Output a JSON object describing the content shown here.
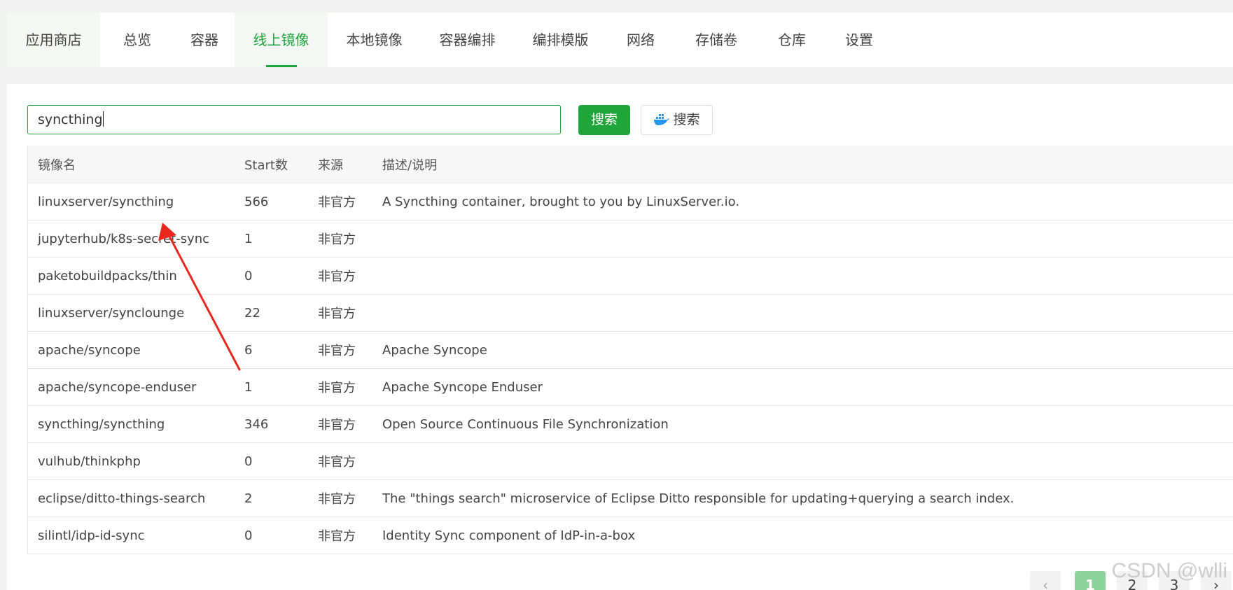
{
  "tabs": [
    {
      "label": "应用商店"
    },
    {
      "label": "总览"
    },
    {
      "label": "容器"
    },
    {
      "label": "线上镜像"
    },
    {
      "label": "本地镜像"
    },
    {
      "label": "容器编排"
    },
    {
      "label": "编排模版"
    },
    {
      "label": "网络"
    },
    {
      "label": "存储卷"
    },
    {
      "label": "仓库"
    },
    {
      "label": "设置"
    }
  ],
  "search": {
    "value": "syncthing",
    "button_label": "搜索",
    "docker_button_label": "搜索"
  },
  "table": {
    "headers": [
      "镜像名",
      "Start数",
      "来源",
      "描述/说明"
    ],
    "rows": [
      {
        "name": "linuxserver/syncthing",
        "stars": "566",
        "source": "非官方",
        "desc": "A Syncthing container, brought to you by LinuxServer.io."
      },
      {
        "name": "jupyterhub/k8s-secret-sync",
        "stars": "1",
        "source": "非官方",
        "desc": ""
      },
      {
        "name": "paketobuildpacks/thin",
        "stars": "0",
        "source": "非官方",
        "desc": ""
      },
      {
        "name": "linuxserver/synclounge",
        "stars": "22",
        "source": "非官方",
        "desc": ""
      },
      {
        "name": "apache/syncope",
        "stars": "6",
        "source": "非官方",
        "desc": "Apache Syncope"
      },
      {
        "name": "apache/syncope-enduser",
        "stars": "1",
        "source": "非官方",
        "desc": "Apache Syncope Enduser"
      },
      {
        "name": "syncthing/syncthing",
        "stars": "346",
        "source": "非官方",
        "desc": "Open Source Continuous File Synchronization"
      },
      {
        "name": "vulhub/thinkphp",
        "stars": "0",
        "source": "非官方",
        "desc": ""
      },
      {
        "name": "eclipse/ditto-things-search",
        "stars": "2",
        "source": "非官方",
        "desc": "The \"things search\" microservice of Eclipse Ditto responsible for updating+querying a search index."
      },
      {
        "name": "silintl/idp-id-sync",
        "stars": "0",
        "source": "非官方",
        "desc": "Identity Sync component of IdP-in-a-box"
      }
    ]
  },
  "pagination": {
    "prev": "‹",
    "pages": [
      "1",
      "2",
      "3"
    ],
    "next": "›"
  },
  "watermark": "CSDN @wlli",
  "colors": {
    "accent": "#20a53a",
    "annotation_arrow": "#e8281f"
  }
}
